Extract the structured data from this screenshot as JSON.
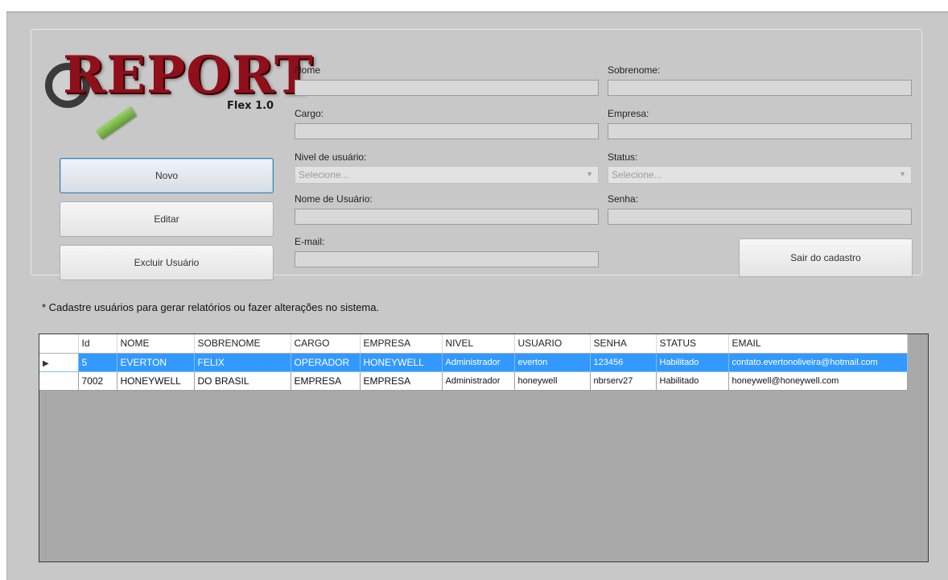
{
  "logo": {
    "title": "REPORT",
    "subtitle": "Flex 1.0"
  },
  "buttons": {
    "novo": "Novo",
    "editar": "Editar",
    "excluir": "Excluir Usuário",
    "sair": "Sair do cadastro"
  },
  "form": {
    "nome_label": "Nome",
    "sobrenome_label": "Sobrenome:",
    "cargo_label": "Cargo:",
    "empresa_label": "Empresa:",
    "nivel_label": "Nivel de usuário:",
    "nivel_placeholder": "Selecione...",
    "status_label": "Status:",
    "status_placeholder": "Selecione...",
    "usuario_label": "Nome de Usuário:",
    "senha_label": "Senha:",
    "email_label": "E-mail:"
  },
  "hint": "* Cadastre usuários para gerar relatórios ou fazer alterações no sistema.",
  "grid": {
    "columns": [
      "Id",
      "NOME",
      "SOBRENOME",
      "CARGO",
      "EMPRESA",
      "NIVEL",
      "USUARIO",
      "SENHA",
      "STATUS",
      "EMAIL"
    ],
    "rows": [
      {
        "pointer": "▶",
        "cells": [
          "5",
          "EVERTON",
          "FELIX",
          "OPERADOR",
          "HONEYWELL",
          "Administrador",
          "everton",
          "123456",
          "Habilitado",
          "contato.evertonoliveira@hotmail.com"
        ]
      },
      {
        "pointer": "",
        "cells": [
          "7002",
          "HONEYWELL",
          "DO BRASIL",
          "EMPRESA",
          "EMPRESA",
          "Administrador",
          "honeywell",
          "nbrserv27",
          "Habilitado",
          "honeywell@honeywell.com"
        ]
      }
    ]
  },
  "colors": {
    "selection": "#3399ff",
    "logo_red": "#8f0f1a",
    "active_border": "#3c7fb1"
  }
}
